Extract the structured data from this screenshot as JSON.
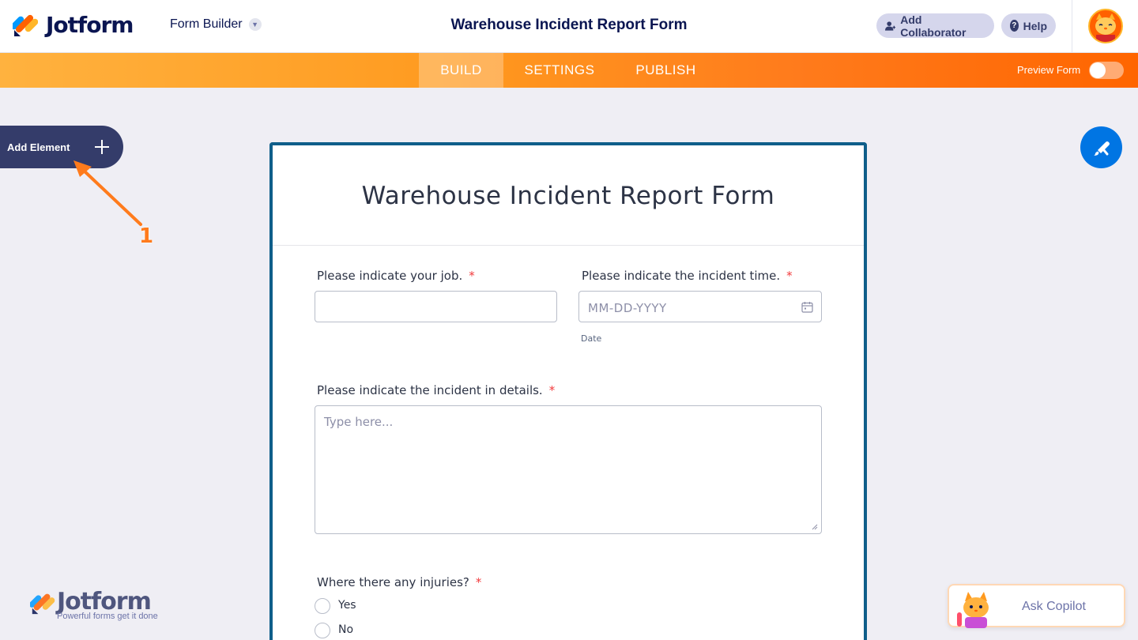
{
  "header": {
    "logo_text": "Jotform",
    "builder_label": "Form Builder",
    "title": "Warehouse Incident Report Form",
    "add_collaborator": "Add Collaborator",
    "help": "Help"
  },
  "nav": {
    "tabs": [
      {
        "label": "BUILD",
        "active": true
      },
      {
        "label": "SETTINGS",
        "active": false
      },
      {
        "label": "PUBLISH",
        "active": false
      }
    ],
    "preview_label": "Preview Form",
    "preview_on": false
  },
  "sidebar": {
    "add_element": "Add Element",
    "annotation_number": "1"
  },
  "form": {
    "title": "Warehouse Incident Report Form",
    "required_mark": "*",
    "fields": {
      "job": {
        "label": "Please indicate your job.",
        "value": ""
      },
      "time": {
        "label": "Please indicate the incident time.",
        "placeholder": "MM-DD-YYYY",
        "sublabel": "Date"
      },
      "details": {
        "label": "Please indicate the incident in details.",
        "placeholder": "Type here..."
      },
      "injuries": {
        "label": "Where there any injuries?",
        "options": [
          "Yes",
          "No"
        ]
      }
    }
  },
  "branding": {
    "word": "Jotform",
    "tagline": "Powerful forms get it done"
  },
  "copilot": {
    "label": "Ask Copilot"
  },
  "colors": {
    "navy": "#0a1551",
    "orange_start": "#ffb23f",
    "orange_end": "#ff6500",
    "form_border": "#0f5e8a",
    "accent_blue": "#0075e3",
    "required_red": "#f23a3c"
  }
}
